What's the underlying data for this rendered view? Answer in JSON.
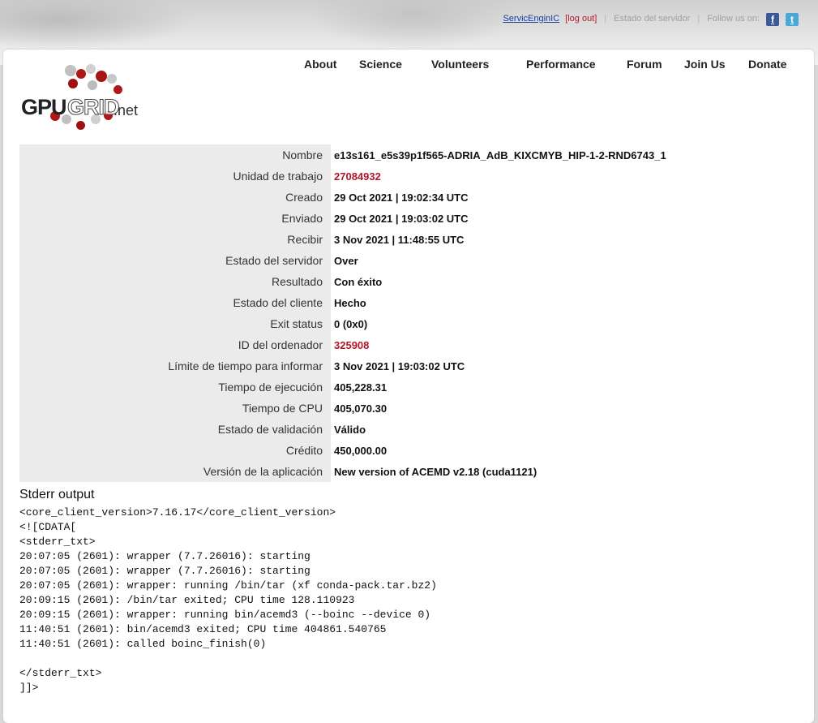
{
  "topbar": {
    "user": "ServicEnginIC",
    "logout": "[log out]",
    "server_status": "Estado del servidor",
    "follow": "Follow us on:",
    "facebook_glyph": "f",
    "twitter_glyph": "t"
  },
  "logo": {
    "gpu": "GPU",
    "grid": "GRID",
    "net": ".net"
  },
  "nav": [
    "About",
    "Science",
    "Volunteers",
    "Performance",
    "Forum",
    "Join Us",
    "Donate"
  ],
  "details": [
    {
      "label": "Nombre",
      "value": "e13s161_e5s39p1f565-ADRIA_AdB_KIXCMYB_HIP-1-2-RND6743_1",
      "link": false
    },
    {
      "label": "Unidad de trabajo",
      "value": "27084932",
      "link": true
    },
    {
      "label": "Creado",
      "value": "29 Oct 2021 | 19:02:34 UTC",
      "link": false
    },
    {
      "label": "Enviado",
      "value": "29 Oct 2021 | 19:03:02 UTC",
      "link": false
    },
    {
      "label": "Recibir",
      "value": "3 Nov 2021 | 11:48:55 UTC",
      "link": false
    },
    {
      "label": "Estado del servidor",
      "value": "Over",
      "link": false
    },
    {
      "label": "Resultado",
      "value": "Con éxito",
      "link": false
    },
    {
      "label": "Estado del cliente",
      "value": "Hecho",
      "link": false
    },
    {
      "label": "Exit status",
      "value": "0 (0x0)",
      "link": false
    },
    {
      "label": "ID del ordenador",
      "value": "325908",
      "link": true
    },
    {
      "label": "Límite de tiempo para informar",
      "value": "3 Nov 2021 | 19:03:02 UTC",
      "link": false
    },
    {
      "label": "Tiempo de ejecución",
      "value": "405,228.31",
      "link": false
    },
    {
      "label": "Tiempo de CPU",
      "value": "405,070.30",
      "link": false
    },
    {
      "label": "Estado de validación",
      "value": "Válido",
      "link": false
    },
    {
      "label": "Crédito",
      "value": "450,000.00",
      "link": false
    },
    {
      "label": "Versión de la aplicación",
      "value": "New version of ACEMD v2.18 (cuda1121)",
      "link": false
    }
  ],
  "stderr": {
    "heading": "Stderr output",
    "lines": [
      "<core_client_version>7.16.17</core_client_version>",
      "<![CDATA[",
      "<stderr_txt>",
      "20:07:05 (2601): wrapper (7.7.26016): starting",
      "20:07:05 (2601): wrapper (7.7.26016): starting",
      "20:07:05 (2601): wrapper: running /bin/tar (xf conda-pack.tar.bz2)",
      "20:09:15 (2601): /bin/tar exited; CPU time 128.110923",
      "20:09:15 (2601): wrapper: running bin/acemd3 (--boinc --device 0)",
      "11:40:51 (2601): bin/acemd3 exited; CPU time 404861.540765",
      "11:40:51 (2601): called boinc_finish(0)",
      "",
      "</stderr_txt>",
      "]]>"
    ]
  },
  "colors": {
    "link_red": "#b0182a",
    "link_blue": "#1a3d9e",
    "label_bg": "#ebebeb"
  }
}
